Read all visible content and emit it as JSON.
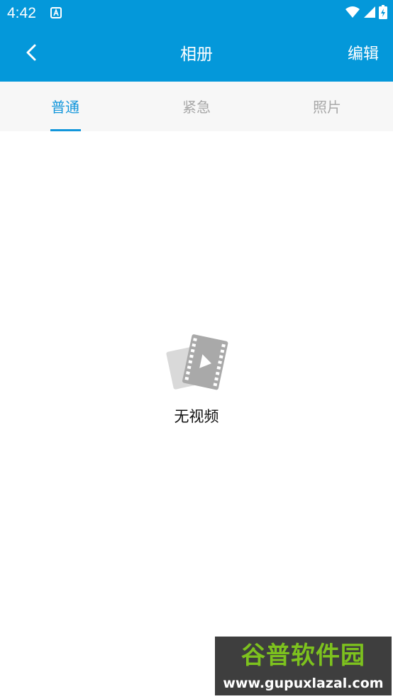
{
  "status_bar": {
    "time": "4:42",
    "app_icon": "a-notification-icon",
    "wifi_icon": "wifi-icon",
    "signal_icon": "cell-signal-icon",
    "battery_icon": "battery-icon"
  },
  "toolbar": {
    "title": "相册",
    "edit_label": "编辑",
    "back_icon": "chevron-left-icon"
  },
  "tabs": [
    {
      "label": "普通",
      "active": true
    },
    {
      "label": "紧急",
      "active": false
    },
    {
      "label": "照片",
      "active": false
    }
  ],
  "empty_state": {
    "icon": "video-film-icon",
    "message": "无视频"
  },
  "watermark": {
    "title": "谷普软件园",
    "url": "www.gupuxlazal.com"
  },
  "colors": {
    "header": "#0498DA",
    "tab_active": "#1296DB",
    "tab_inactive": "#A8A8A8",
    "tab_bar_bg": "#F7F7F7"
  }
}
